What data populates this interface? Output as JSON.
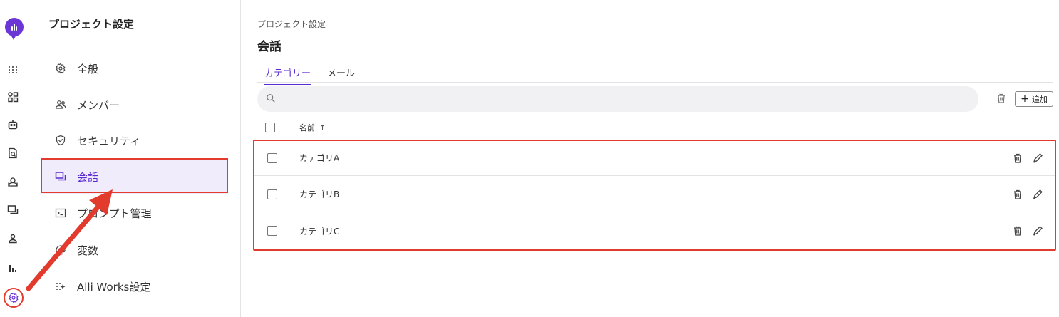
{
  "sidebar_nav": {
    "title": "プロジェクト設定",
    "items": [
      {
        "label": "全般",
        "icon": "gear-icon"
      },
      {
        "label": "メンバー",
        "icon": "users-icon"
      },
      {
        "label": "セキュリティ",
        "icon": "shield-icon"
      },
      {
        "label": "会話",
        "icon": "chat-icon",
        "active": true
      },
      {
        "label": "プロンプト管理",
        "icon": "terminal-icon"
      },
      {
        "label": "変数",
        "icon": "at-icon"
      },
      {
        "label": "Alli Works設定",
        "icon": "sparkle-icon"
      }
    ]
  },
  "rail": {
    "icons": [
      "app-logo-icon",
      "grid-icon",
      "apps-icon",
      "bot-icon",
      "document-search-icon",
      "knowledge-icon",
      "conversation-icon",
      "user-icon",
      "analytics-icon",
      "settings-icon"
    ],
    "active": "settings-icon"
  },
  "main": {
    "breadcrumb": "プロジェクト設定",
    "title": "会話",
    "tabs": [
      {
        "label": "カテゴリー",
        "active": true
      },
      {
        "label": "メール",
        "active": false
      }
    ],
    "search": {
      "placeholder": ""
    },
    "add_button": "追加",
    "table": {
      "header_name": "名前",
      "sort_indicator": "↑",
      "rows": [
        {
          "name": "カテゴリA"
        },
        {
          "name": "カテゴリB"
        },
        {
          "name": "カテゴリC"
        }
      ]
    }
  },
  "colors": {
    "accent": "#5a2bd0",
    "brand": "#6c35d6",
    "annotation_red": "#e23b2e",
    "active_bg": "#f1ecfb"
  }
}
